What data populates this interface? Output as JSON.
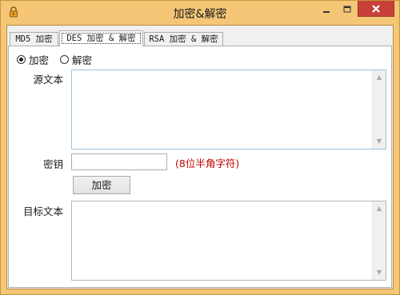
{
  "window": {
    "title": "加密&解密",
    "icons": {
      "app": "lock-icon",
      "minimize": "minimize-icon",
      "maximize": "maximize-icon",
      "close": "close-icon"
    },
    "colors": {
      "frame": "#f4c676",
      "close": "#c7413a",
      "hint": "#c00000"
    }
  },
  "tabs": [
    {
      "label": "MD5 加密",
      "selected": false
    },
    {
      "label": "DES 加密 & 解密",
      "selected": true
    },
    {
      "label": "RSA 加密 & 解密",
      "selected": false
    }
  ],
  "mode": {
    "encrypt_label": "加密",
    "decrypt_label": "解密",
    "selected": "encrypt"
  },
  "form": {
    "source_label": "源文本",
    "source_value": "",
    "key_label": "密钥",
    "key_value": "",
    "key_hint": "(8位半角字符)",
    "action_label": "加密",
    "target_label": "目标文本",
    "target_value": ""
  }
}
